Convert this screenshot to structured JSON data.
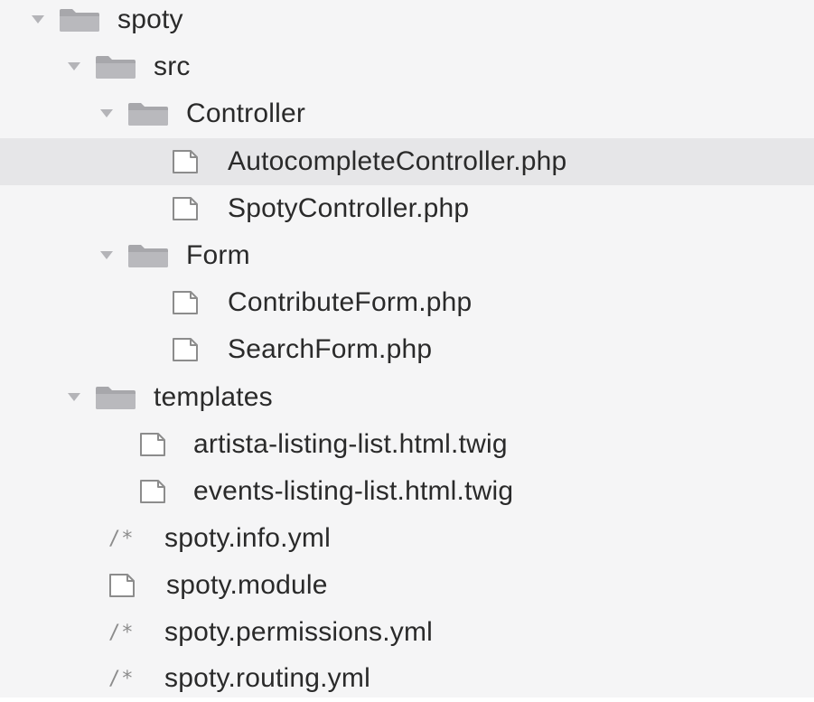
{
  "tree": {
    "root": {
      "label": "spoty",
      "expanded": true
    },
    "src": {
      "label": "src",
      "expanded": true
    },
    "controller": {
      "label": "Controller",
      "expanded": true
    },
    "autocomplete_controller": {
      "label": "AutocompleteController.php",
      "selected": true
    },
    "spoty_controller": {
      "label": "SpotyController.php"
    },
    "form": {
      "label": "Form",
      "expanded": true
    },
    "contribute_form": {
      "label": "ContributeForm.php"
    },
    "search_form": {
      "label": "SearchForm.php"
    },
    "templates": {
      "label": "templates",
      "expanded": true
    },
    "artista_listing": {
      "label": "artista-listing-list.html.twig"
    },
    "events_listing": {
      "label": "events-listing-list.html.twig"
    },
    "info_yml": {
      "label": "spoty.info.yml",
      "icon_text": "/*"
    },
    "module_file": {
      "label": "spoty.module"
    },
    "permissions_yml": {
      "label": "spoty.permissions.yml",
      "icon_text": "/*"
    },
    "routing_yml": {
      "label": "spoty.routing.yml",
      "icon_text": "/*"
    }
  },
  "icons": {
    "folder": "folder-icon",
    "file": "file-icon",
    "yml": "config-file-icon",
    "disclosure": "disclosure-triangle-icon"
  },
  "colors": {
    "panel_background": "#f5f5f6",
    "selected_row": "#e6e6e8",
    "text": "#2a2a2a",
    "icon_gray": "#8c8c8c",
    "folder_fill": "#a7a7ab"
  }
}
